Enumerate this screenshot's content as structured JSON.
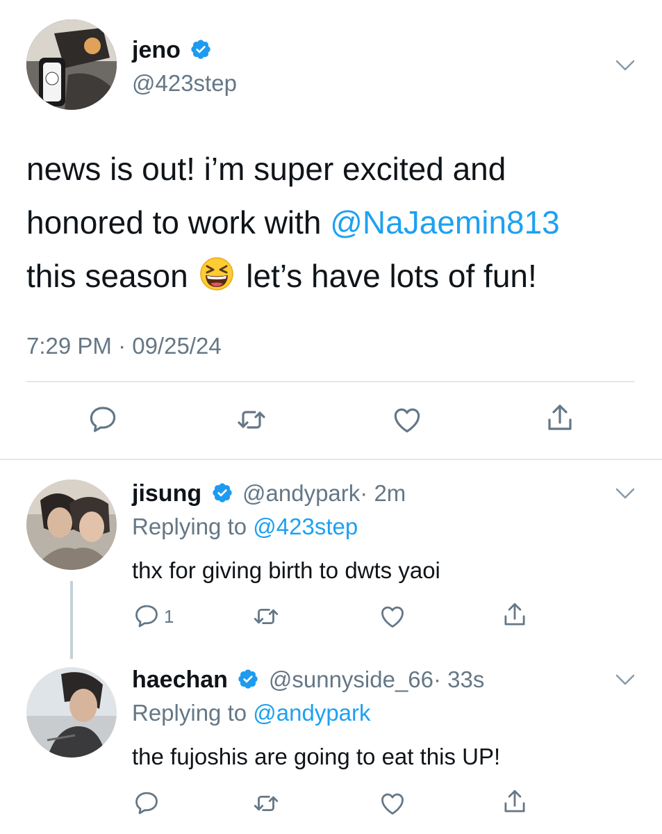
{
  "colors": {
    "accent": "#1da1f2",
    "verified": "#1d9bf0",
    "gray": "#657786",
    "divider": "#e1e8ed"
  },
  "main_tweet": {
    "name": "jeno",
    "handle": "@423step",
    "text_part1": "news is out! i’m super excited and",
    "text_part2": "honored to work with ",
    "mention": "@NaJaemin813",
    "text_part3": "this season ",
    "emoji": "😆",
    "text_part4": " let’s have lots of fun!",
    "timestamp": "7:29 PM · 09/25/24"
  },
  "replies": [
    {
      "name": "jisung",
      "handle": "@andypark",
      "time": "· 2m",
      "replying_label": "Replying to ",
      "replying_to": "@423step",
      "text": "thx for giving birth to dwts yaoi",
      "reply_count": "1"
    },
    {
      "name": "haechan",
      "handle": "@sunnyside_66",
      "time": "· 33s",
      "replying_label": "Replying to ",
      "replying_to": "@andypark",
      "text": "the fujoshis are going to eat this UP!",
      "reply_count": ""
    }
  ],
  "icons": [
    "reply-icon",
    "retweet-icon",
    "like-icon",
    "share-icon",
    "chevron-down-icon",
    "verified-badge-icon"
  ]
}
